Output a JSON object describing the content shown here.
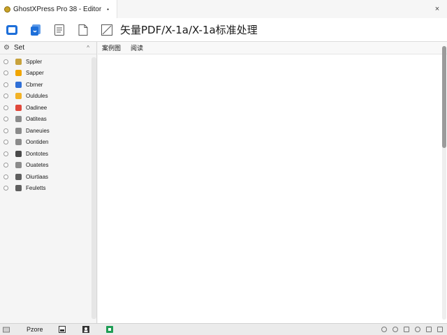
{
  "window": {
    "tab_title": "GhostXPress Pro 38 - Editor",
    "tab_marker": "•",
    "close_glyph": "×"
  },
  "toolbar": {
    "heading": "矢量PDF/X-1a/X-1a标准处理"
  },
  "sidebar": {
    "header": "Set",
    "collapse_glyph": "^",
    "items": [
      {
        "label": "Sppler",
        "icon": "note-icon",
        "color": "#c8a23c"
      },
      {
        "label": "Sapper",
        "icon": "star-icon",
        "color": "#f0a500"
      },
      {
        "label": "Cbrner",
        "icon": "blue-square-icon",
        "color": "#2f6fd6"
      },
      {
        "label": "Ouldules",
        "icon": "tag-icon",
        "color": "#f2b227"
      },
      {
        "label": "Oadinee",
        "icon": "red-square-icon",
        "color": "#e0483b"
      },
      {
        "label": "Oatiteas",
        "icon": "frame-icon",
        "color": "#8b8b8b"
      },
      {
        "label": "Daneuies",
        "icon": "monitor-icon",
        "color": "#8b8b8b"
      },
      {
        "label": "Oontiden",
        "icon": "window-icon",
        "color": "#8b8b8b"
      },
      {
        "label": "Dontotes",
        "icon": "dark-frame-icon",
        "color": "#4a4a4a"
      },
      {
        "label": "Ouatetes",
        "icon": "box-icon",
        "color": "#8b8b8b"
      },
      {
        "label": "Oiurtiaas",
        "icon": "archive-icon",
        "color": "#5f5f5f"
      },
      {
        "label": "Feuletts",
        "icon": "file-icon",
        "color": "#5f5f5f"
      }
    ]
  },
  "content": {
    "columns": [
      "案例图",
      "阅读"
    ]
  },
  "statusbar": {
    "label": "Pzore"
  },
  "colors": {
    "primary_blue": "#1e6fd9",
    "scroll_thumb": "#9b9b9b"
  }
}
